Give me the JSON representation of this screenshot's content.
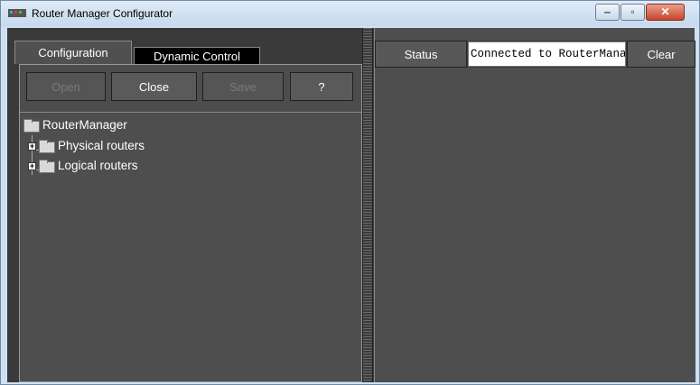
{
  "window": {
    "title": "Router Manager Configurator",
    "minimize_glyph": "‒",
    "maximize_glyph": "▫",
    "close_glyph": "✕"
  },
  "tabs": {
    "configuration": "Configuration",
    "dynamic_control": "Dynamic Control"
  },
  "toolbar": {
    "open": "Open",
    "close": "Close",
    "save": "Save",
    "help": "?"
  },
  "tree": {
    "root": "RouterManager",
    "children": [
      "Physical routers",
      "Logical routers"
    ]
  },
  "status": {
    "label": "Status",
    "value": "Connected to RouterManager",
    "clear": "Clear"
  },
  "colors": {
    "panel_bg": "#4e4e4e",
    "accent_close": "#c4442a"
  }
}
